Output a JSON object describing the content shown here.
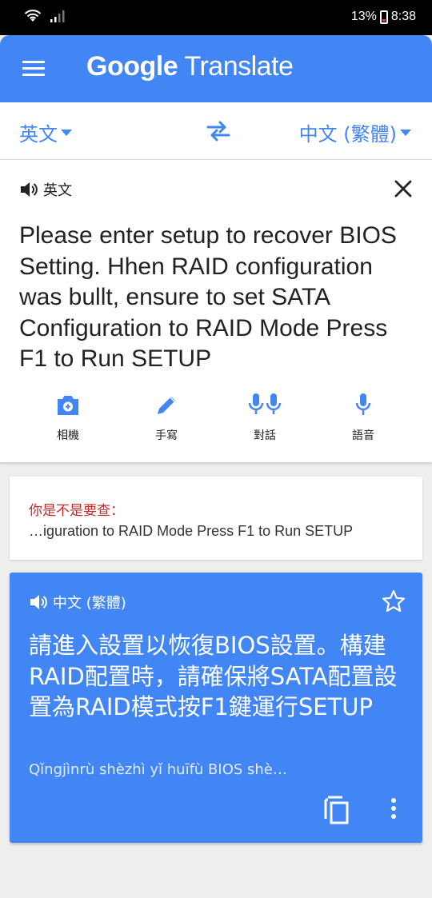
{
  "status_bar": {
    "battery": "13%",
    "time": "8:38"
  },
  "app": {
    "title_google": "Google",
    "title_translate": "Translate"
  },
  "languages": {
    "source": "英文",
    "target": "中文 (繁體)"
  },
  "input": {
    "language_label": "英文",
    "text": "Please enter setup to recover BIOS Setting. Hhen RAID configuration was bullt, ensure to set SATA Configuration to RAID Mode Press F1 to Run SETUP"
  },
  "tools": [
    {
      "label": "相機",
      "icon": "camera-icon"
    },
    {
      "label": "手寫",
      "icon": "pen-icon"
    },
    {
      "label": "對話",
      "icon": "conversation-mic-icon"
    },
    {
      "label": "語音",
      "icon": "mic-icon"
    }
  ],
  "suggestion": {
    "heading": "你是不是要查：",
    "text": "…iguration to RAID Mode Press F1 to Run SETUP"
  },
  "result": {
    "language_label": "中文 (繁體)",
    "text": "請進入設置以恢復BIOS設置。構建RAID配置時，請確保將SATA配置設置為RAID模式按F1鍵運行SETUP",
    "pinyin": "Qǐngjìnrù shèzhì yǐ huīfù BIOS shè…"
  },
  "colors": {
    "brand_blue": "#4285f4",
    "suggest_red": "#c62828"
  }
}
